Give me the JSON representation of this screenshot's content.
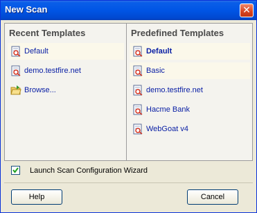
{
  "window": {
    "title": "New Scan",
    "close_label": "✕"
  },
  "recent": {
    "header": "Recent Templates",
    "items": [
      {
        "label": "Default"
      },
      {
        "label": "demo.testfire.net"
      },
      {
        "label": "Browse..."
      }
    ]
  },
  "predefined": {
    "header": "Predefined Templates",
    "items": [
      {
        "label": "Default"
      },
      {
        "label": "Basic"
      },
      {
        "label": "demo.testfire.net"
      },
      {
        "label": "Hacme Bank"
      },
      {
        "label": "WebGoat v4"
      }
    ]
  },
  "wizard": {
    "label": "Launch Scan Configuration Wizard",
    "checked": true
  },
  "buttons": {
    "help": "Help",
    "cancel": "Cancel"
  },
  "colors": {
    "title_bar": "#0055e5",
    "link": "#0b20a5",
    "close": "#d8431f"
  },
  "icons": {
    "template": "scan-template-icon",
    "browse": "folder-open-icon",
    "check": "check-icon"
  }
}
